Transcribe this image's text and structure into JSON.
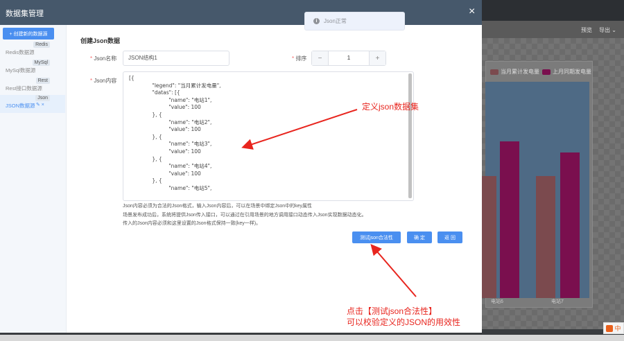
{
  "modal": {
    "title": "数据集管理",
    "close_icon": "×"
  },
  "toast": {
    "text": "Json正常",
    "icon": "i"
  },
  "sidebar": {
    "create_button": "+ 创建新的数据源",
    "items": [
      {
        "tag": "Redis",
        "label": "Redis数据源"
      },
      {
        "tag": "MySql",
        "label": "MySql数据源"
      },
      {
        "tag": "Rest",
        "label": "Rest接口数据源"
      },
      {
        "tag": "Json",
        "label": "JSON数据源",
        "actions": "✎ ×"
      }
    ]
  },
  "form": {
    "title": "创建Json数据",
    "name_label": "Json名称",
    "name_value": "JSON结构1",
    "sort_label": "排序",
    "sort_value": "1",
    "sort_minus": "−",
    "sort_plus": "+",
    "content_label": "Json内容",
    "content": "[{\n              \"legend\": \"当月累计发电量\",\n              \"datas\": [{\n                        \"name\": \"电站1\",\n                        \"value\": 100\n              }, {\n                        \"name\": \"电站2\",\n                        \"value\": 100\n              }, {\n                        \"name\": \"电站3\",\n                        \"value\": 100\n              }, {\n                        \"name\": \"电站4\",\n                        \"value\": 100\n              }, {\n                        \"name\": \"电站5\",",
    "help_lines": [
      "Json内容必须为合法的Json格式，输入Json内容后，可以在场景中绑定Json中的key属性",
      "场景发布成功后，系统将提供Json传入接口，可以通过在引用场景的地方调用接口动态传入Json实现数据动态化。",
      "传入的Json内容必须和这里设置的Json格式保持一致(key一样)。"
    ],
    "buttons": {
      "test": "测试json合法性",
      "confirm": "确 定",
      "back": "返 回"
    }
  },
  "annotations": {
    "define": "定义json数据集",
    "click_line1": "点击【测试json合法性】",
    "click_line2": "可以校验定义的JSON的用效性",
    "color": "#e8251e"
  },
  "background": {
    "toolbar": {
      "preview": "预览",
      "export": "导出 ⌄"
    },
    "legend": [
      "当月累计发电量",
      "上月同期发电量"
    ],
    "x_ticks": [
      "电站6",
      "电站7"
    ],
    "colors": {
      "series1": "#7b4a4e",
      "series2": "#7a0f4e"
    }
  }
}
